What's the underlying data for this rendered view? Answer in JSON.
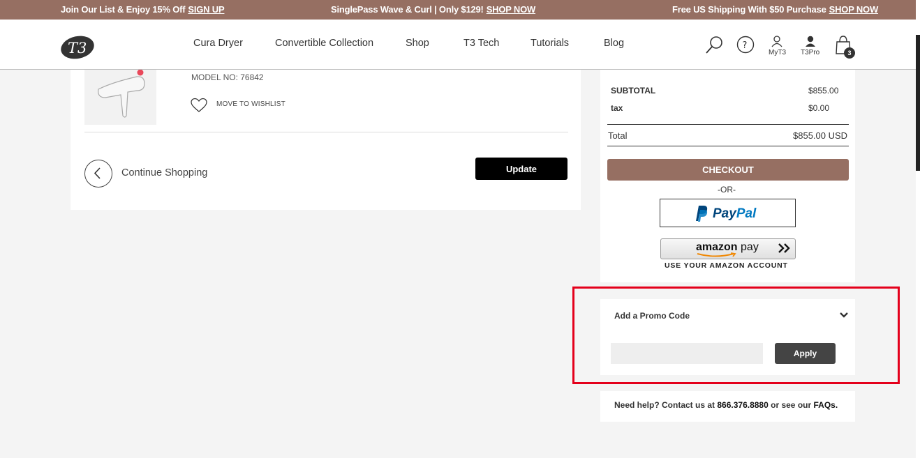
{
  "topbar": {
    "msg1_text": "Join Our List & Enjoy 15% Off",
    "msg1_link": "SIGN UP",
    "msg2_text": "SinglePass Wave & Curl | Only $129!",
    "msg2_link": "SHOP NOW",
    "msg3_text": "Free US Shipping With $50 Purchase",
    "msg3_link": "SHOP NOW"
  },
  "header": {
    "logo_icon": "t3-logo",
    "nav": [
      "Cura Dryer",
      "Convertible Collection",
      "Shop",
      "T3 Tech",
      "Tutorials",
      "Blog"
    ],
    "myt3_label": "MyT3",
    "t3pro_label": "T3Pro",
    "bag_count": "3"
  },
  "cart": {
    "model": "MODEL NO: 76842",
    "wishlist_label": "MOVE TO WISHLIST",
    "continue_label": "Continue Shopping",
    "update_label": "Update"
  },
  "summary": {
    "subtotal_label": "SUBTOTAL",
    "subtotal_value": "$855.00",
    "tax_label": "tax",
    "tax_value": "$0.00",
    "total_label": "Total",
    "total_value": "$855.00 USD",
    "checkout_label": "CHECKOUT",
    "or_label": "-OR-",
    "paypal_pay": "Pay",
    "paypal_pal": "Pal",
    "amazon_brand": "amazon",
    "amazon_pay": "pay",
    "amazon_caption": "USE YOUR AMAZON ACCOUNT"
  },
  "promo": {
    "title": "Add a Promo Code",
    "input_value": "",
    "apply_label": "Apply"
  },
  "help": {
    "prefix": "Need help? Contact us at",
    "phone": "866.376.8880",
    "middle": "or see our",
    "faqs": "FAQs."
  },
  "colors": {
    "brand": "#966f62",
    "highlight": "#e4001b",
    "paypal_blue": "#0079c1"
  }
}
